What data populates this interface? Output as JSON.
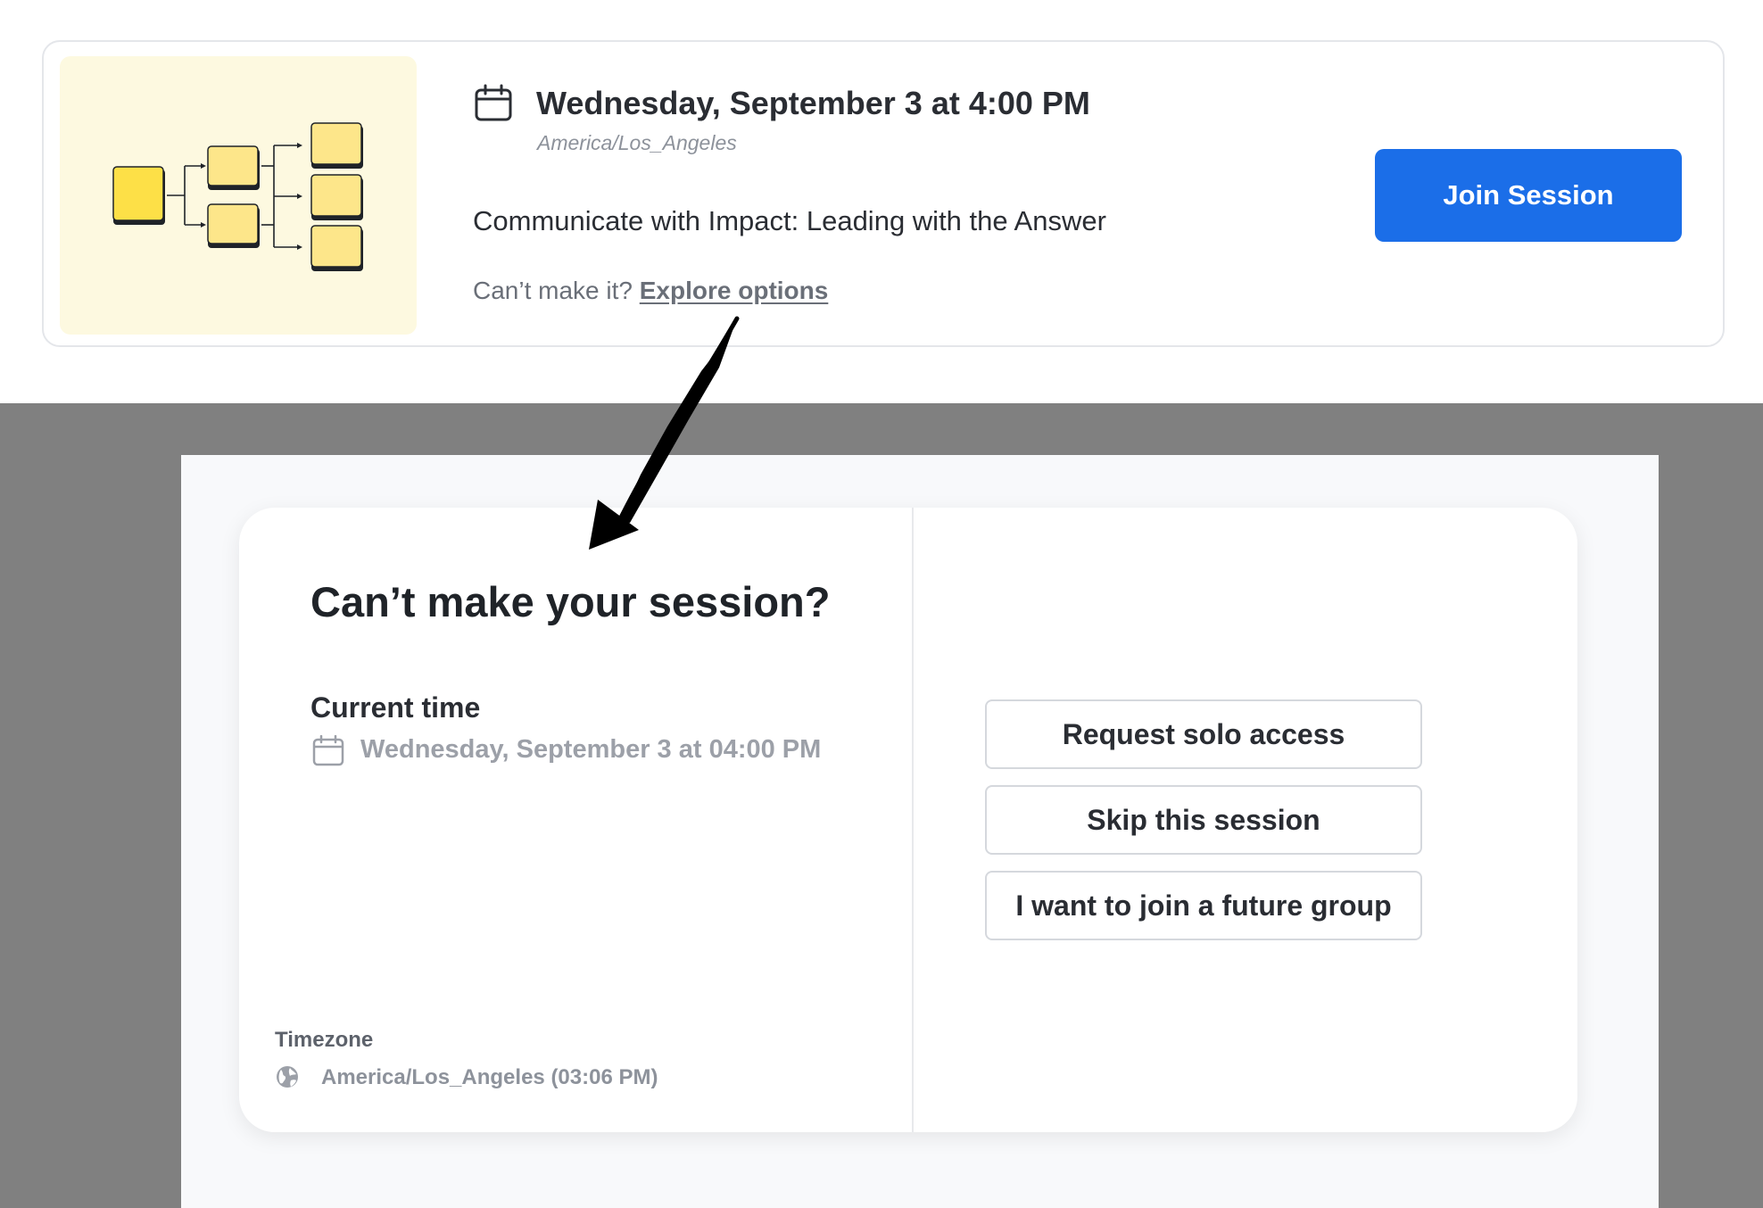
{
  "session_card": {
    "datetime": "Wednesday, September 3 at 4:00 PM",
    "timezone": "America/Los_Angeles",
    "title": "Communicate with Impact: Leading with the Answer",
    "cant_make_prefix": "Can’t make it?",
    "explore_link": "Explore options",
    "join_button": "Join Session",
    "thumbnail_icon": "tree-diagram-illustration",
    "calendar_icon": "calendar-icon",
    "colors": {
      "primary_button": "#1b6ee8",
      "thumbnail_bg": "#fdf9e0",
      "node_yellow": "#fde68a",
      "root_node_yellow": "#fde047"
    }
  },
  "dialog": {
    "title": "Can’t make your session?",
    "current_time_label": "Current time",
    "current_time_value": "Wednesday, September 3 at 04:00 PM",
    "timezone_label": "Timezone",
    "timezone_value": "America/Los_Angeles (03:06 PM)",
    "timezone_icon": "globe-icon",
    "options": [
      "Request solo access",
      "Skip this session",
      "I want to join a future group"
    ]
  },
  "annotation": {
    "arrow": "callout-arrow"
  }
}
